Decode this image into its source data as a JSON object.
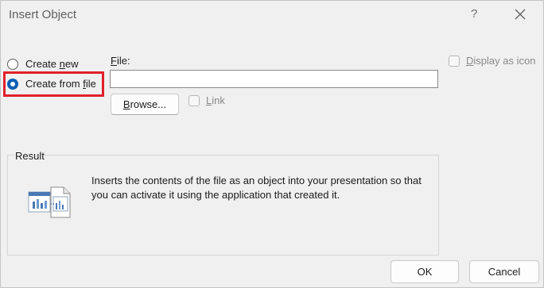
{
  "dialog": {
    "title": "Insert Object",
    "help_label": "?"
  },
  "options": {
    "create_new_label": "Create new",
    "create_new_pre": "Create ",
    "create_new_key": "n",
    "create_new_post": "ew",
    "create_from_file_pre": "Create from ",
    "create_from_file_key": "f",
    "create_from_file_post": "ile",
    "selected": "create_from_file"
  },
  "file": {
    "label": "File:",
    "label_key": "F",
    "label_rest": "ile:",
    "value": "",
    "browse_pre": "",
    "browse_key": "B",
    "browse_post": "rowse...",
    "link_key": "L",
    "link_rest": "ink"
  },
  "display_as_icon": {
    "key": "D",
    "rest": "isplay as icon",
    "checked": false
  },
  "result": {
    "label": "Result",
    "text": "Inserts the contents of the file as an object into your presentation so that you can activate it using the application that created it."
  },
  "buttons": {
    "ok": "OK",
    "cancel": "Cancel"
  }
}
